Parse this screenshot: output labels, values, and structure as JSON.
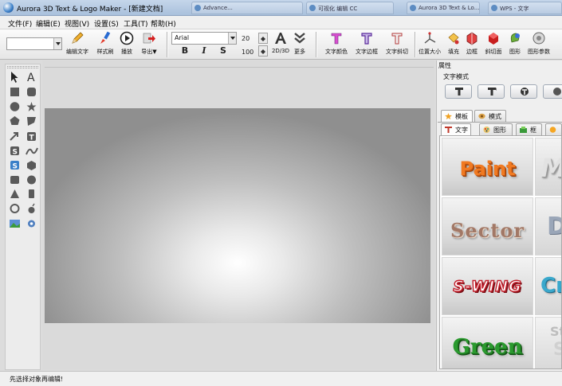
{
  "window": {
    "title": "Aurora 3D Text & Logo Maker - [新建文档]",
    "background_tabs": [
      "Advance...",
      "可视化 编辑 CC",
      "Aurora 3D Text & Lo...",
      "WPS - 文字"
    ]
  },
  "menu": [
    "文件(F)",
    "编辑(E)",
    "视图(V)",
    "设置(S)",
    "工具(T)",
    "帮助(H)"
  ],
  "toolbar": {
    "combo_value": "",
    "font_family": "Arial",
    "font_size": "20",
    "bevel_value": "100",
    "bold_label": "B",
    "italic_label": "I",
    "shadow_label": "S",
    "mode_label": "2D/3D",
    "tools": {
      "edit_text": "编辑文字",
      "format_brush": "样式刷",
      "play": "播放",
      "export": "导出▼",
      "more": "更多",
      "text_color": "文字颜色",
      "text_border": "文字边框",
      "text_bevel": "文字斜切",
      "position_size": "位置大小",
      "fill": "填充",
      "border": "边框",
      "bevel_face": "斜切面",
      "shape": "图形",
      "shape_params": "图形参数"
    }
  },
  "properties": {
    "header": "属性",
    "subheader": "文字模式",
    "tabs_row1": [
      "模板",
      "模式"
    ],
    "tabs_row2": [
      "文字",
      "图形",
      "框",
      ""
    ],
    "gallery": [
      "Paint",
      "Sector",
      "S-WING",
      "Green",
      "M",
      "D",
      "Cr",
      "St"
    ]
  },
  "colors": {
    "paint": "#f07a22",
    "sector": "#a27866",
    "swing": "#c21e2a",
    "green": "#2a9a2e",
    "cr": "#3aa8cc"
  },
  "status": "先选择对象再编辑!"
}
